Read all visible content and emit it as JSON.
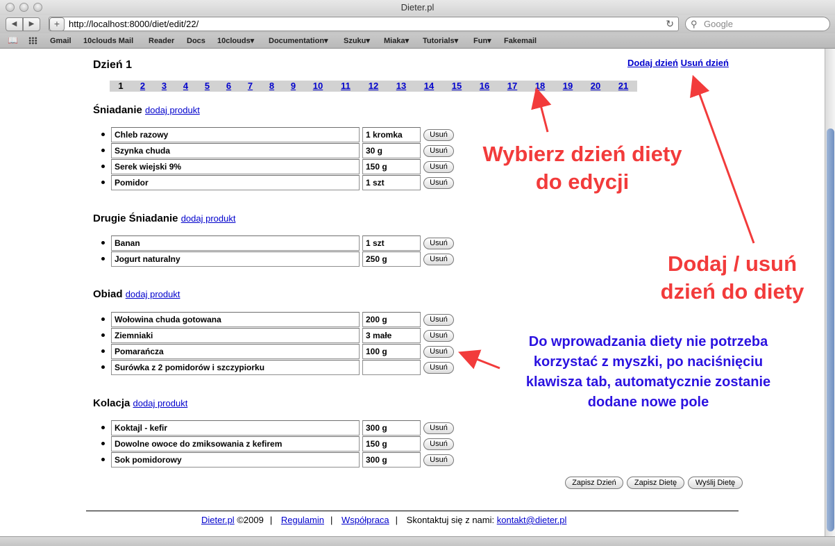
{
  "browser": {
    "window_title": "Dieter.pl",
    "url": "http://localhost:8000/diet/edit/22/",
    "search_placeholder": "Google",
    "bookmarks": [
      "Gmail",
      "10clouds Mail",
      "Reader",
      "Docs",
      "10clouds▾",
      "Documentation▾",
      "Szuku▾",
      "Miaka▾",
      "Tutorials▾",
      "Fun▾",
      "Fakemail"
    ]
  },
  "page": {
    "day_title": "Dzień 1",
    "add_day": "Dodaj dzień",
    "remove_day": "Usuń dzień",
    "day_tabs": [
      "1",
      "2",
      "3",
      "4",
      "5",
      "6",
      "7",
      "8",
      "9",
      "10",
      "11",
      "12",
      "13",
      "14",
      "15",
      "16",
      "17",
      "18",
      "19",
      "20",
      "21"
    ],
    "current_day": "1",
    "add_product_label": "dodaj produkt",
    "remove_label": "Usuń",
    "meals": [
      {
        "title": "Śniadanie",
        "items": [
          {
            "product": "Chleb razowy",
            "qty": "1 kromka"
          },
          {
            "product": "Szynka chuda",
            "qty": "30 g"
          },
          {
            "product": "Serek wiejski 9%",
            "qty": "150 g"
          },
          {
            "product": "Pomidor",
            "qty": "1 szt"
          }
        ]
      },
      {
        "title": "Drugie Śniadanie",
        "items": [
          {
            "product": "Banan",
            "qty": "1 szt"
          },
          {
            "product": "Jogurt naturalny",
            "qty": "250 g"
          }
        ]
      },
      {
        "title": "Obiad",
        "items": [
          {
            "product": "Wołowina chuda gotowana",
            "qty": "200 g"
          },
          {
            "product": "Ziemniaki",
            "qty": "3 małe"
          },
          {
            "product": "Pomarańcza",
            "qty": "100 g"
          },
          {
            "product": "Surówka z 2 pomidorów i szczypiorku",
            "qty": ""
          }
        ]
      },
      {
        "title": "Kolacja",
        "items": [
          {
            "product": "Koktajl - kefir",
            "qty": "300 g"
          },
          {
            "product": "Dowolne owoce do zmiksowania z kefirem",
            "qty": "150 g"
          },
          {
            "product": "Sok pomidorowy",
            "qty": "300 g"
          }
        ]
      }
    ],
    "buttons": {
      "save_day": "Zapisz Dzień",
      "save_diet": "Zapisz Dietę",
      "send_diet": "Wyślij Dietę"
    },
    "footer": {
      "site": "Dieter.pl",
      "copyright": "©2009",
      "terms": "Regulamin",
      "cooperation": "Współpraca",
      "contact_label": "Skontaktuj się z nami:",
      "contact_email": "kontakt@dieter.pl"
    }
  },
  "annotations": {
    "choose_day": [
      "Wybierz dzień diety",
      "do edycji"
    ],
    "add_remove": [
      "Dodaj / usuń",
      "dzień do diety"
    ],
    "keyboard": [
      "Do wprowadzania diety nie potrzeba",
      "korzystać z myszki, po naciśnięciu",
      "klawisza tab, automatycznie zostanie",
      "dodane nowe pole"
    ],
    "red_color": "#f23b3b",
    "blue_color": "#2b12e0"
  }
}
